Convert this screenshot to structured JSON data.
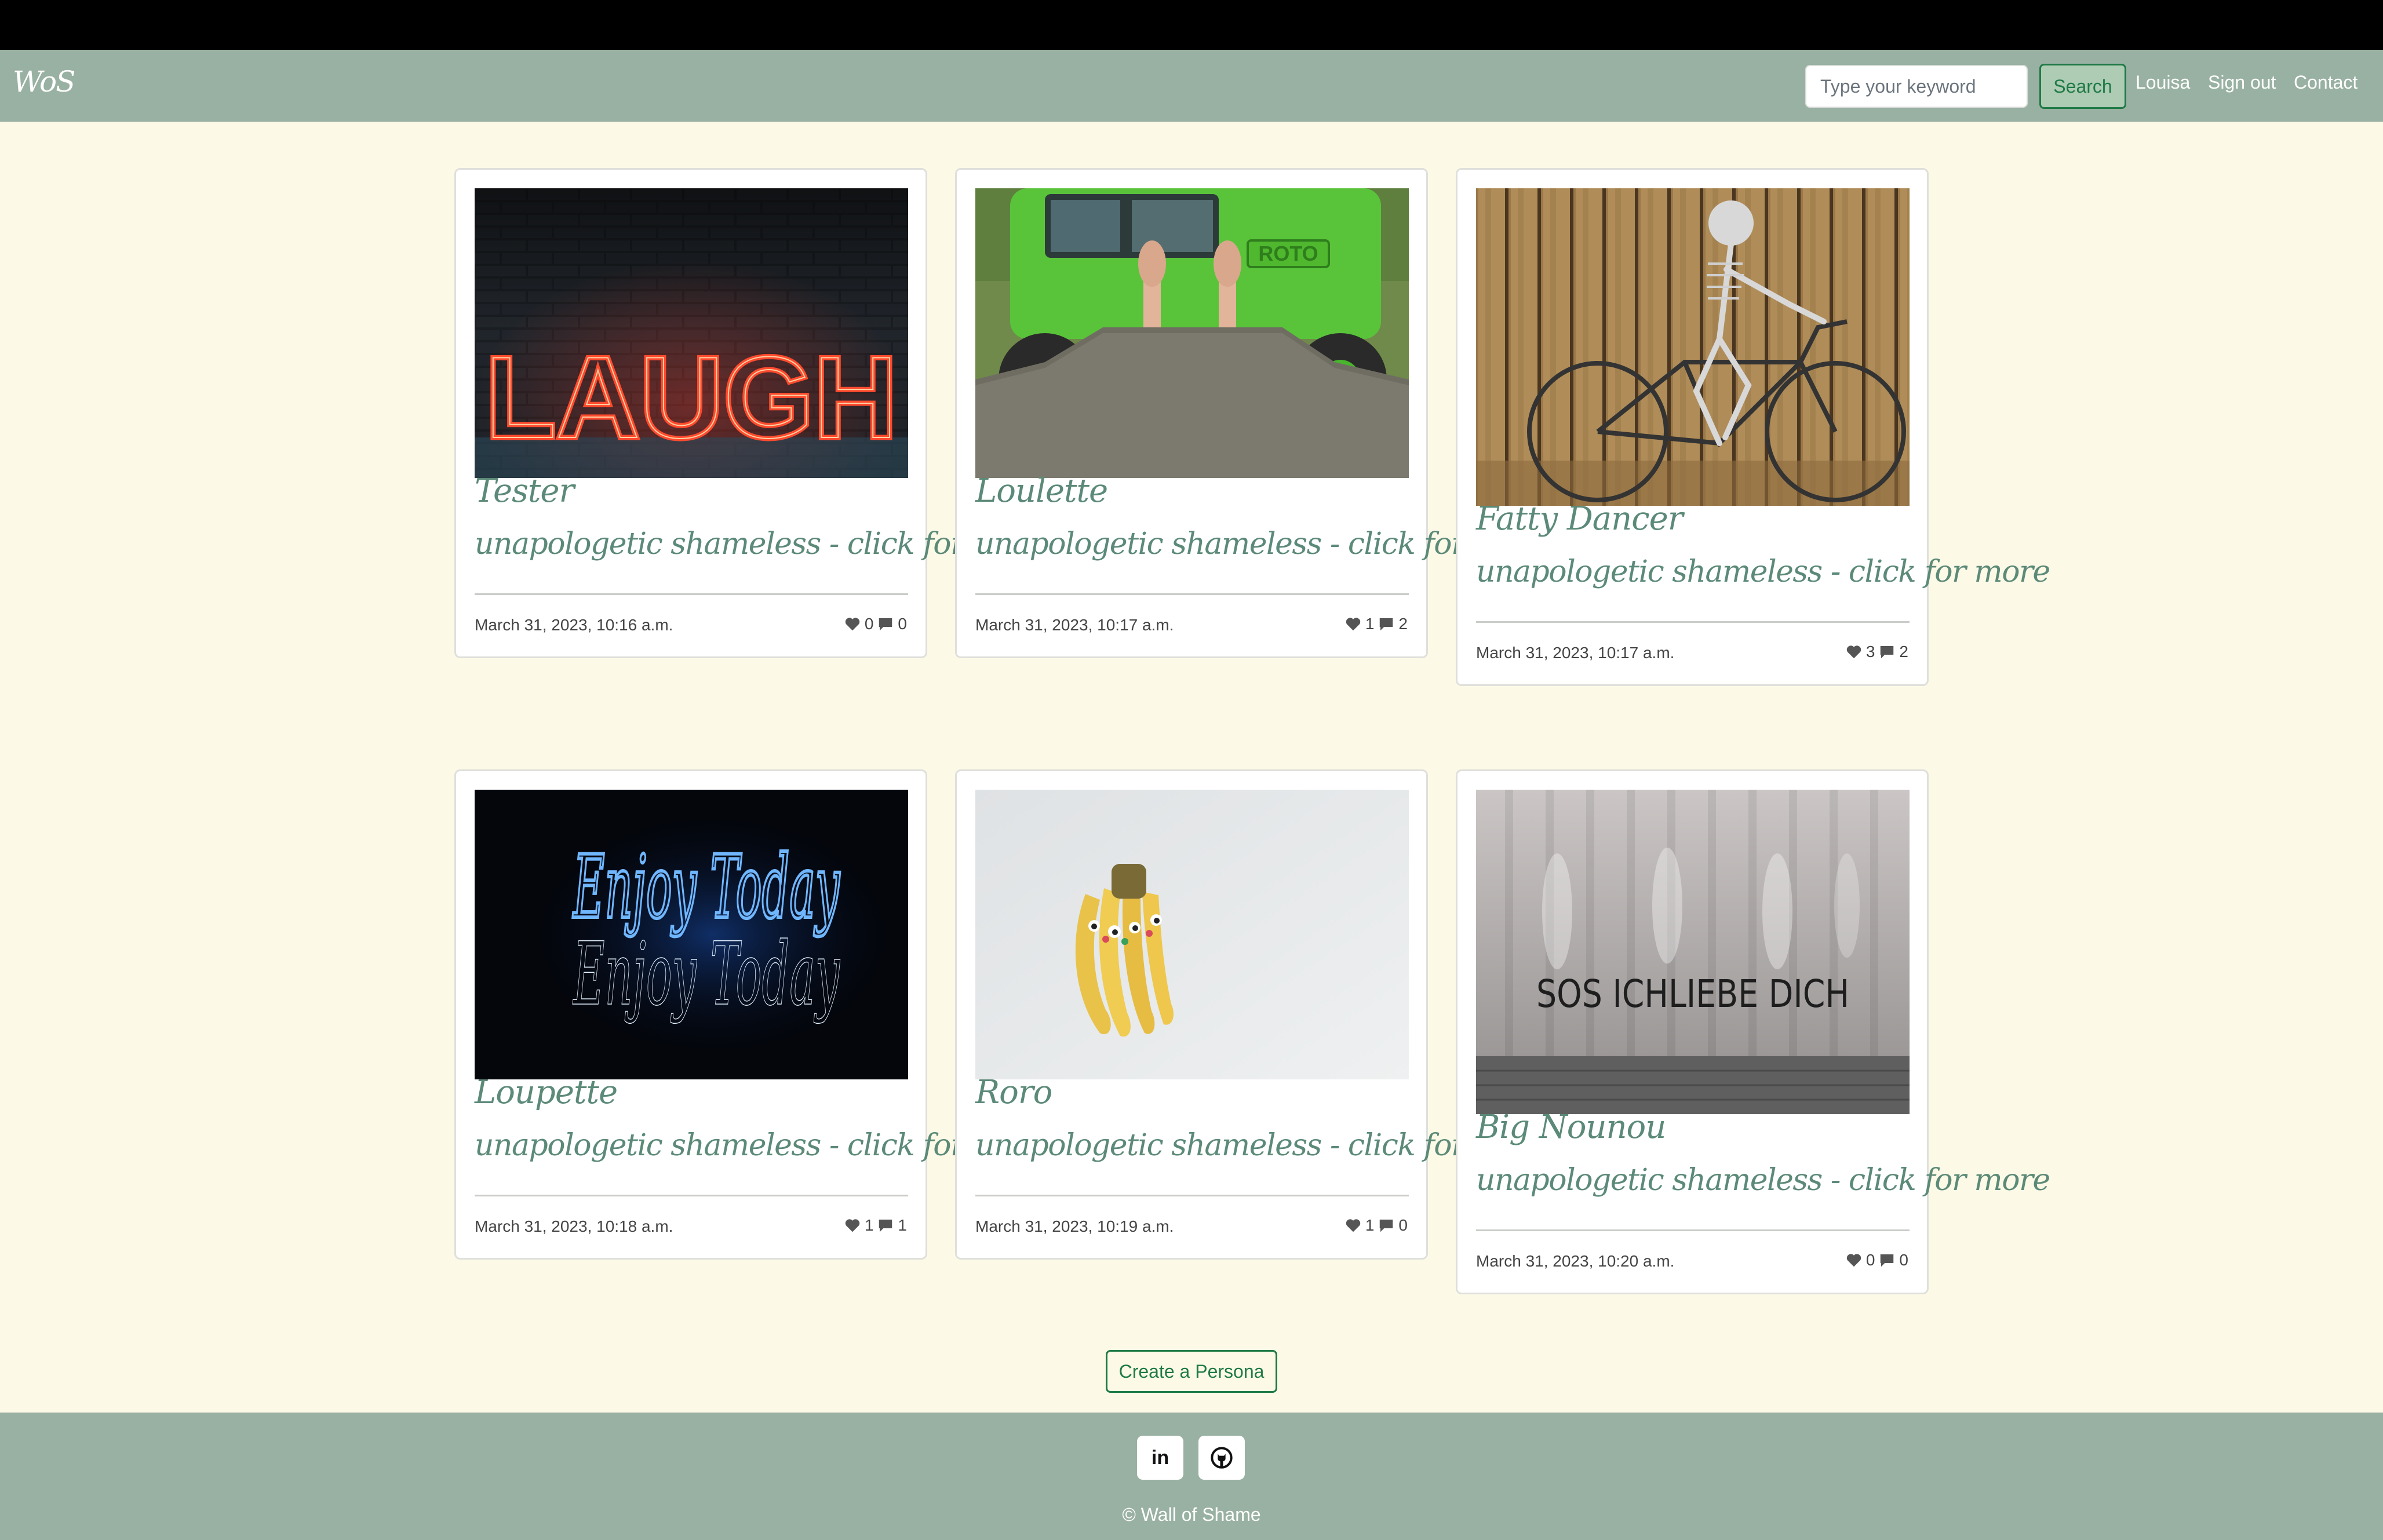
{
  "header": {
    "brand": "WoS",
    "search_placeholder": "Type your keyword",
    "search_label": "Search",
    "nav": [
      "Louisa",
      "Sign out",
      "Contact"
    ]
  },
  "cards": [
    {
      "name": "Tester",
      "tagline": "unapologetic shameless - click for more",
      "date": "March 31, 2023, 10:16 a.m.",
      "likes": "0",
      "comments": "0",
      "image": "neon LAUGH sign on brick wall",
      "image_text": "LAUGH"
    },
    {
      "name": "Loulette",
      "tagline": "unapologetic shameless - click for more",
      "date": "March 31, 2023, 10:17 a.m.",
      "likes": "1",
      "comments": "2",
      "image": "feet sticking up from green loader bucket",
      "image_text": "ROTO"
    },
    {
      "name": "Fatty Dancer",
      "tagline": "unapologetic shameless - click for more",
      "date": "March 31, 2023, 10:17 a.m.",
      "likes": "3",
      "comments": "2",
      "image": "skeleton riding bicycle against wooden fence",
      "image_text": ""
    },
    {
      "name": "Loupette",
      "tagline": "unapologetic shameless - click for more",
      "date": "March 31, 2023, 10:18 a.m.",
      "likes": "1",
      "comments": "1",
      "image": "blue neon Enjoy Today sign",
      "image_text": "Enjoy Today"
    },
    {
      "name": "Roro",
      "tagline": "unapologetic shameless - click for more",
      "date": "March 31, 2023, 10:19 a.m.",
      "likes": "1",
      "comments": "0",
      "image": "bunch of bananas with googly eyes",
      "image_text": ""
    },
    {
      "name": "Big Nounou",
      "tagline": "unapologetic shameless - click for more",
      "date": "March 31, 2023, 10:20 a.m.",
      "likes": "0",
      "comments": "0",
      "image": "graffiti on grey tarp",
      "image_text": "SOS ICHLIEBE DICH"
    }
  ],
  "create_button": "Create a Persona",
  "footer": {
    "social": [
      "linkedin-icon",
      "github-icon"
    ],
    "linkedin_text": "in",
    "copyright": "© Wall of Shame"
  },
  "colors": {
    "page_bg": "#fcf9e6",
    "navbar_bg": "#99b1a2",
    "accent_green": "#1e7a46",
    "script_text": "#5c8a78"
  }
}
